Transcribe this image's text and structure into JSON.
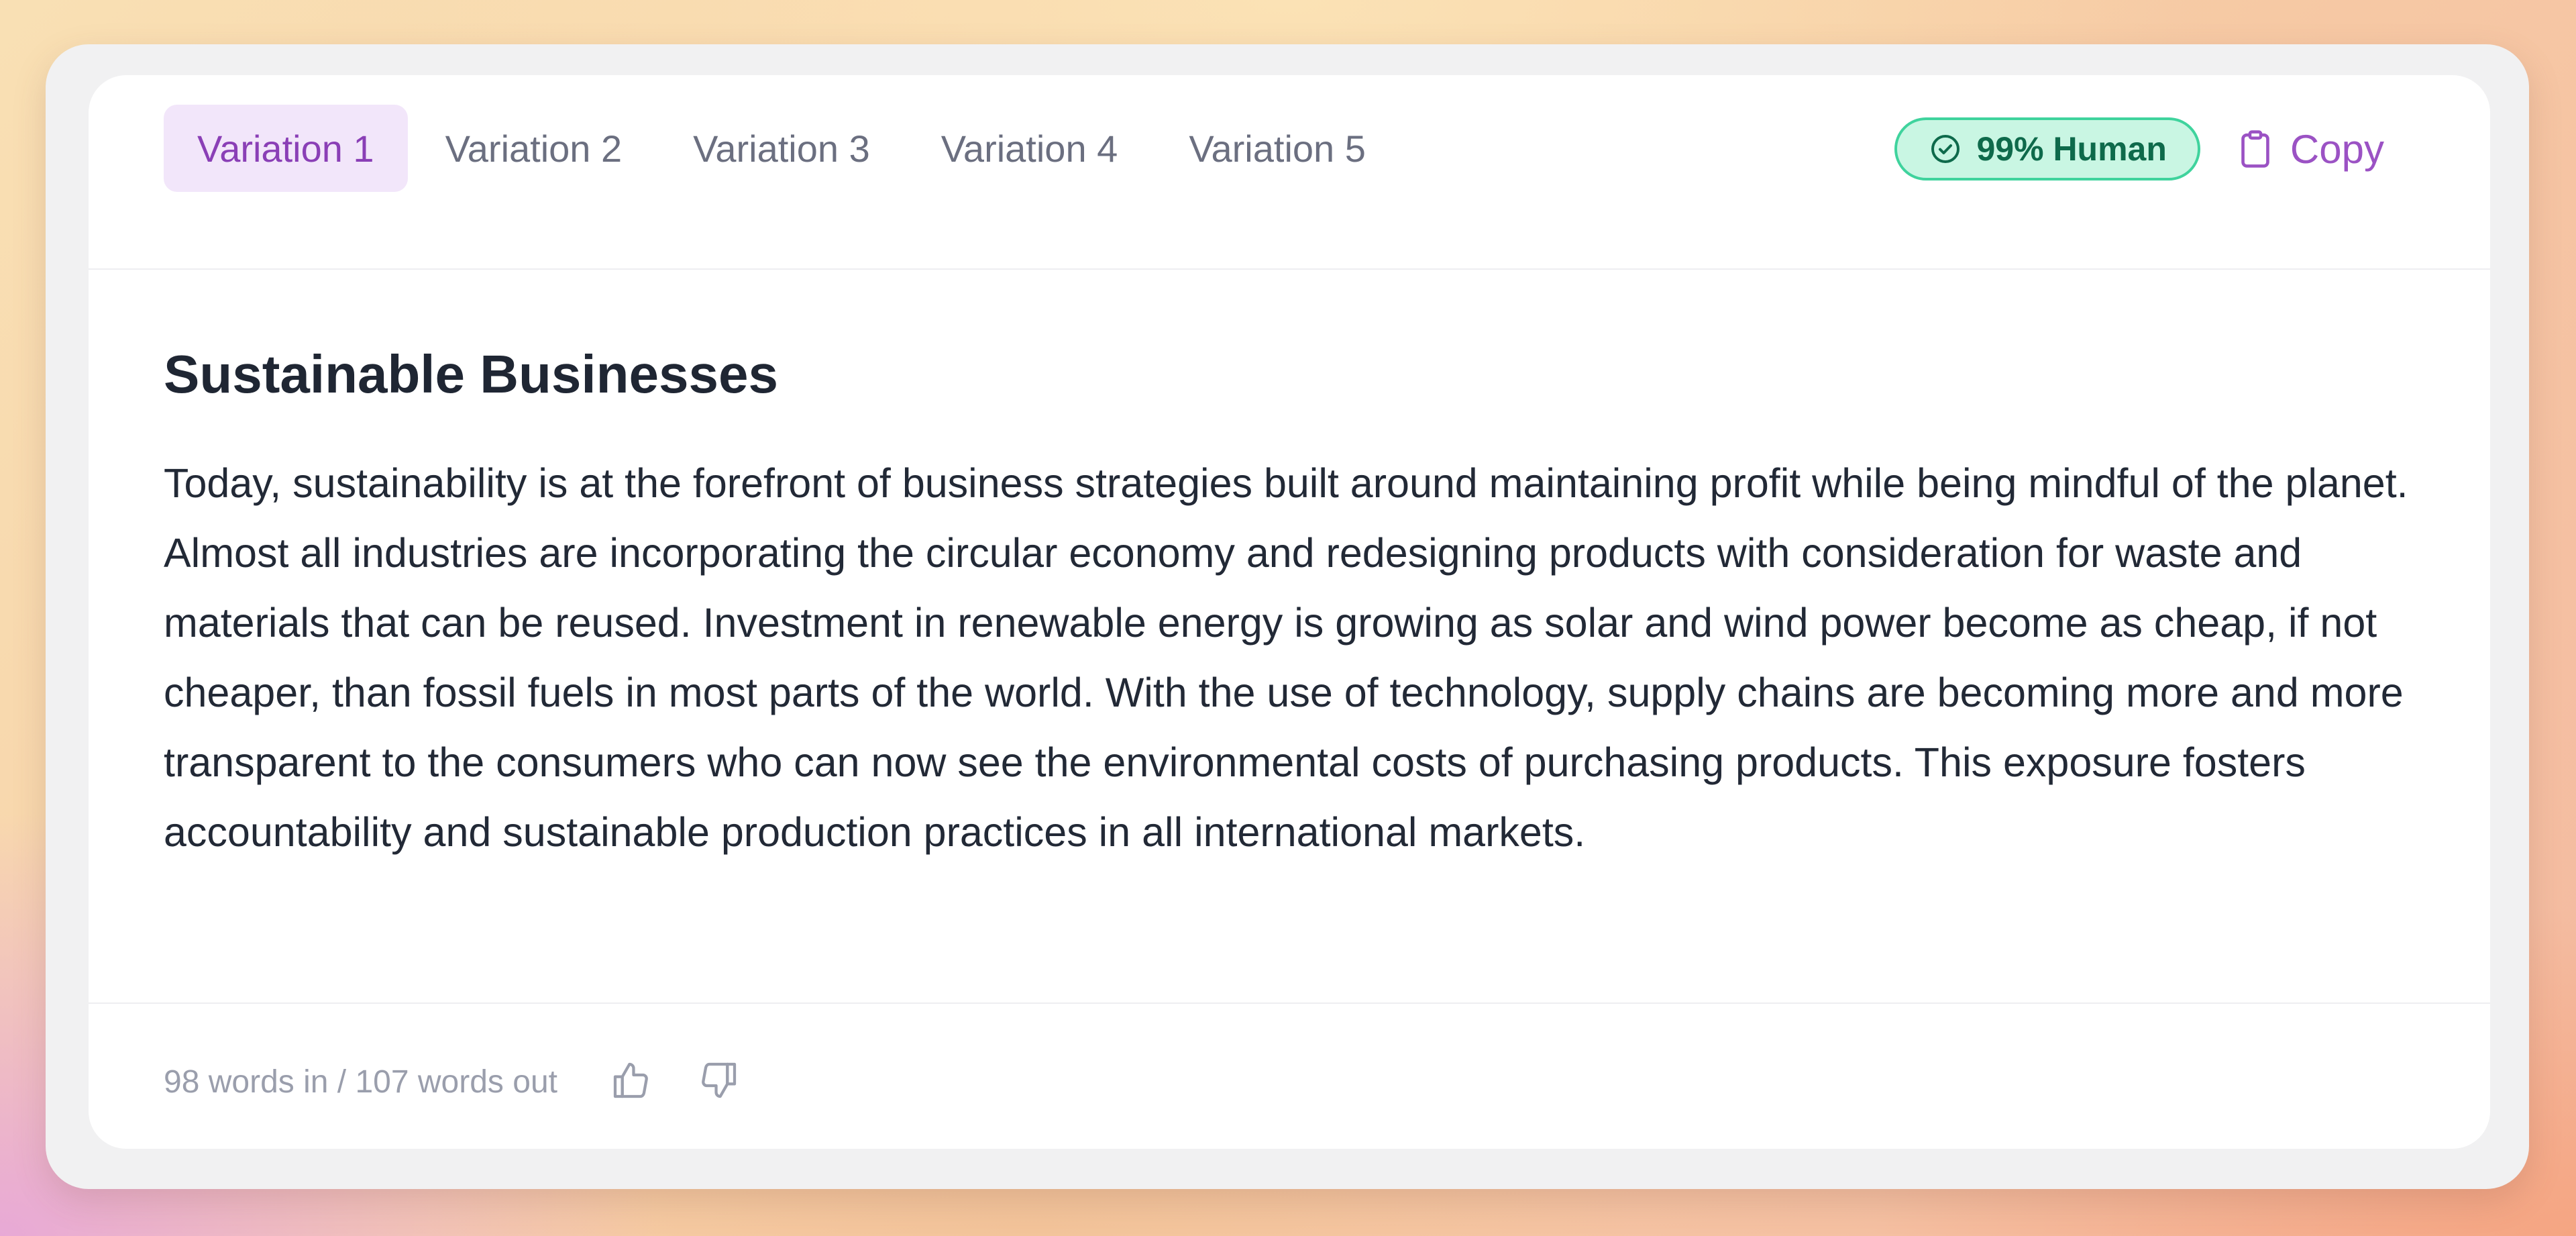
{
  "tabs": [
    {
      "label": "Variation 1",
      "active": true
    },
    {
      "label": "Variation 2",
      "active": false
    },
    {
      "label": "Variation 3",
      "active": false
    },
    {
      "label": "Variation 4",
      "active": false
    },
    {
      "label": "Variation 5",
      "active": false
    }
  ],
  "badge": {
    "label": "99% Human",
    "icon": "check-circle-icon",
    "color": "#3fd39d"
  },
  "copy": {
    "label": "Copy",
    "icon": "clipboard-icon",
    "color": "#9b52c4"
  },
  "article": {
    "title": "Sustainable Businesses",
    "body": "Today, sustainability is at the forefront of business strategies built around maintaining profit while being mindful of the planet. Almost all industries are incorporating the circular economy and redesigning products with consideration for waste and materials that can be reused. Investment in renewable energy is growing as solar and wind power become as cheap, if not cheaper, than fossil fuels in most parts of the world. With the use of technology, supply chains are becoming more and more transparent to the consumers who can now see the environmental costs of purchasing products. This exposure fosters accountability and sustainable production practices in all international markets."
  },
  "footer": {
    "word_count": "98 words in / 107 words out",
    "thumbs_up_icon": "thumbs-up-icon",
    "thumbs_down_icon": "thumbs-down-icon"
  },
  "colors": {
    "accent": "#8a3fb6",
    "active_tab_bg": "#f2e6fa",
    "badge_bg": "#c9f6e3",
    "badge_text": "#0e6a4b"
  }
}
